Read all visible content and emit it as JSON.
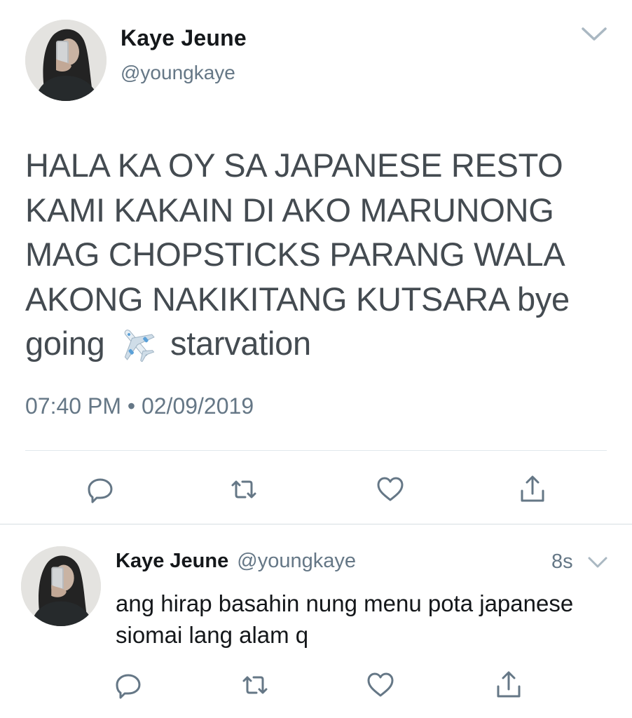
{
  "main_tweet": {
    "author_name": "Kaye Jeune",
    "author_handle": "@youngkaye",
    "text_before_emoji": "HALA KA OY SA JAPANESE RESTO KAMI KAKAIN DI AKO MARUNONG MAG CHOPSTICKS PARANG WALA AKONG NAKIKITANG KUTSARA bye going ",
    "emoji": "airplane-emoji",
    "text_after_emoji": " starvation",
    "timestamp": "07:40 PM • 02/09/2019",
    "actions": [
      "reply-icon",
      "retweet-icon",
      "like-icon",
      "share-icon"
    ]
  },
  "reply_tweet": {
    "author_name": "Kaye Jeune",
    "author_handle": "@youngkaye",
    "time_ago": "8s",
    "text": "ang hirap basahin nung menu pota japanese siomai lang alam q",
    "actions": [
      "reply-icon",
      "retweet-icon",
      "like-icon",
      "share-icon"
    ]
  },
  "colors": {
    "primary_text": "#14171a",
    "main_text": "#444b51",
    "secondary_text": "#657786",
    "divider": "#e1e8ed",
    "icon": "#657786"
  }
}
